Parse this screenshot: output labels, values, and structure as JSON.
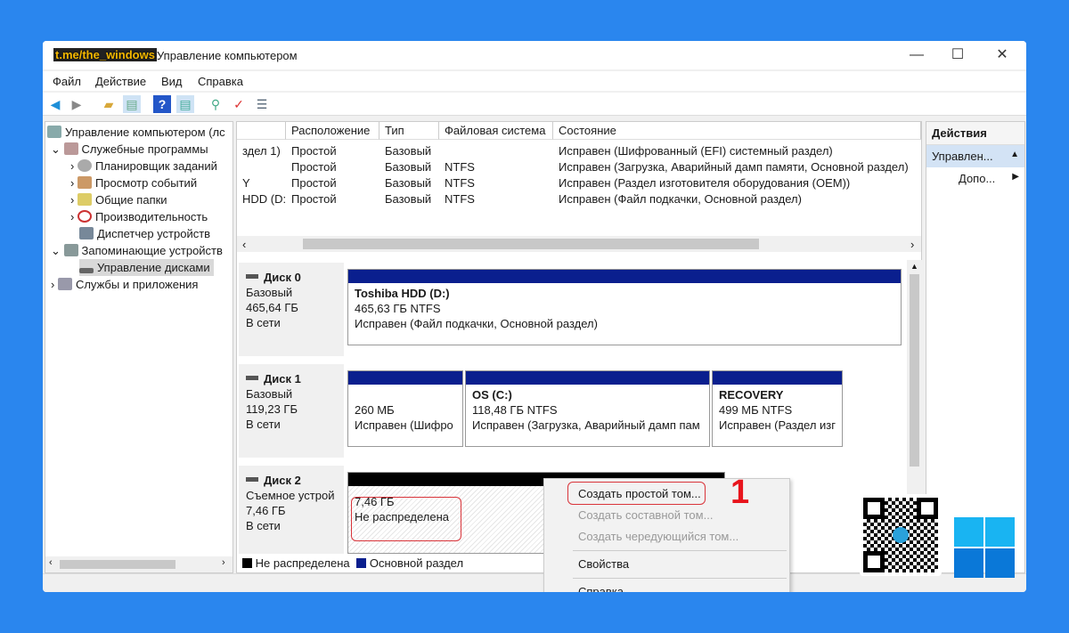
{
  "window": {
    "watermark": "t.me/the_windows",
    "title": "Управление компьютером",
    "min": "—",
    "max": "☐",
    "close": "✕"
  },
  "menu": [
    "Файл",
    "Действие",
    "Вид",
    "Справка"
  ],
  "tree": [
    {
      "label": "Управление компьютером (лс"
    },
    {
      "label": "Служебные программы"
    },
    {
      "label": "Планировщик заданий"
    },
    {
      "label": "Просмотр событий"
    },
    {
      "label": "Общие папки"
    },
    {
      "label": "Производительность"
    },
    {
      "label": "Диспетчер устройств"
    },
    {
      "label": "Запоминающие устройств"
    },
    {
      "label": "Управление дисками"
    },
    {
      "label": "Службы и приложения"
    }
  ],
  "table": {
    "headers": [
      "",
      "Расположение",
      "Тип",
      "Файловая система",
      "Состояние"
    ],
    "rows": [
      [
        "здел 1)",
        "Простой",
        "Базовый",
        "",
        "Исправен (Шифрованный (EFI) системный раздел)"
      ],
      [
        "",
        "Простой",
        "Базовый",
        "NTFS",
        "Исправен (Загрузка, Аварийный дамп памяти, Основной раздел)"
      ],
      [
        "Y",
        "Простой",
        "Базовый",
        "NTFS",
        "Исправен (Раздел изготовителя оборудования (OEM))"
      ],
      [
        "HDD (D:)",
        "Простой",
        "Базовый",
        "NTFS",
        "Исправен (Файл подкачки, Основной раздел)"
      ]
    ]
  },
  "disks": [
    {
      "name": "Диск 0",
      "type": "Базовый",
      "size": "465,64 ГБ",
      "status": "В сети",
      "parts": [
        {
          "title": "Toshiba HDD  (D:)",
          "size": "465,63 ГБ NTFS",
          "state": "Исправен (Файл подкачки, Основной раздел)"
        }
      ]
    },
    {
      "name": "Диск 1",
      "type": "Базовый",
      "size": "119,23 ГБ",
      "status": "В сети",
      "parts": [
        {
          "title": "",
          "size": "260 МБ",
          "state": "Исправен (Шифро"
        },
        {
          "title": "OS  (C:)",
          "size": "118,48 ГБ NTFS",
          "state": "Исправен (Загрузка, Аварийный дамп пам"
        },
        {
          "title": "RECOVERY",
          "size": "499 МБ NTFS",
          "state": "Исправен (Раздел изг"
        }
      ]
    },
    {
      "name": "Диск 2",
      "type": "Съемное устрой",
      "size": "7,46 ГБ",
      "status": "В сети",
      "parts": [
        {
          "size": "7,46 ГБ",
          "state": "Не распределена"
        }
      ]
    }
  ],
  "legend": [
    "Не распределена",
    "Основной раздел"
  ],
  "actions": {
    "header": "Действия",
    "item": "Управлен...",
    "sub": "Допо..."
  },
  "context_menu": [
    "Создать простой том...",
    "Создать составной том...",
    "Создать чередующийся том...",
    "Свойства",
    "Справка"
  ],
  "annotation": "1"
}
